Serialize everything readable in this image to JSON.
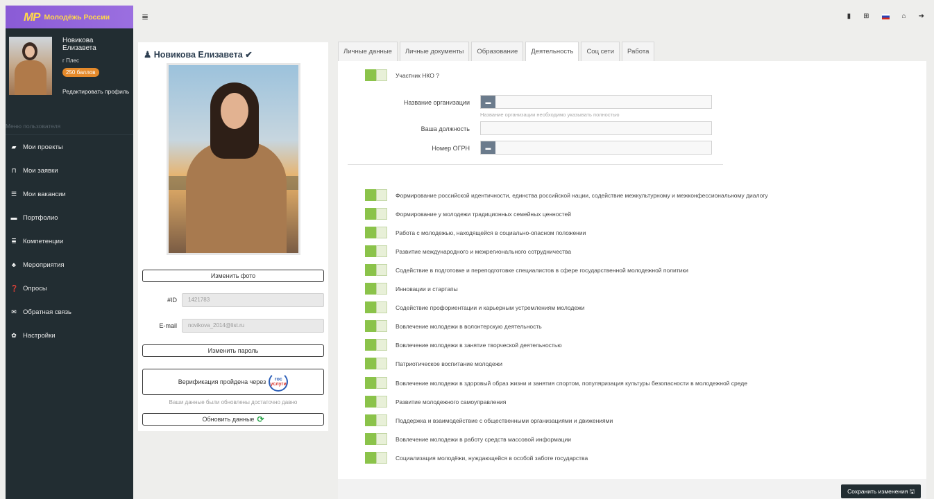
{
  "brand": {
    "mark": "MP",
    "name": "Молодёжь России"
  },
  "user": {
    "first": "Новикова",
    "last": "Елизавета",
    "city": "г Плес",
    "points": "250 баллов",
    "edit": "Редактировать профиль"
  },
  "menu_title": "Меню пользователя",
  "menu": [
    {
      "label": "Мои проекты",
      "icon": "book-icon",
      "glyph": "▰"
    },
    {
      "label": "Мои заявки",
      "icon": "bookmark-icon",
      "glyph": "⊓"
    },
    {
      "label": "Мои вакансии",
      "icon": "list-icon",
      "glyph": "☰"
    },
    {
      "label": "Портфолио",
      "icon": "folder-icon",
      "glyph": "▬"
    },
    {
      "label": "Компетенции",
      "icon": "table-icon",
      "glyph": "≣"
    },
    {
      "label": "Мероприятия",
      "icon": "sitemap-icon",
      "glyph": "♣"
    },
    {
      "label": "Опросы",
      "icon": "question-icon",
      "glyph": "❓"
    },
    {
      "label": "Обратная связь",
      "icon": "envelope-icon",
      "glyph": "✉"
    },
    {
      "label": "Настройки",
      "icon": "gear-icon",
      "glyph": "✿"
    }
  ],
  "profile": {
    "title": "Новикова Елизавета ✔",
    "change_photo": "Изменить фото",
    "id_label": "#ID",
    "id_value": "1421783",
    "email_label": "E-mail",
    "email_value": "novikova_2014@list.ru",
    "change_password": "Изменить пароль",
    "verification": "Верификация пройдена через",
    "gos_top": "гос",
    "gos_bottom": "услуги",
    "note": "Ваши данные были обновлены достаточно давно",
    "update": "Обновить данные"
  },
  "tabs": [
    "Личные данные",
    "Личные документы",
    "Образование",
    "Деятельность",
    "Соц сети",
    "Работа"
  ],
  "active_tab": "Деятельность",
  "nko": {
    "label": "Участник НКО ?",
    "org_label": "Название организации",
    "org_hint": "Название организации необходимо указывать полностью",
    "position_label": "Ваша должность",
    "ogrn_label": "Номер ОГРН"
  },
  "activities": [
    "Формирование российской идентичности, единства российской нации, содействие межкультурному и межконфессиональному диалогу",
    "Формирование у молодежи традиционных семейных ценностей",
    "Работа с молодежью, находящейся в социально-опасном положении",
    "Развитие международного и межрегионального сотрудничества",
    "Содействие в подготовке и переподготовке специалистов в сфере государственной молодежной политики",
    "Инновации и стартапы",
    "Содействие профориентации и карьерным устремлениям молодежи",
    "Вовлечение молодежи в волонтерскую деятельность",
    "Вовлечение молодежи в занятие творческой деятельностью",
    "Патриотическое воспитание молодежи",
    "Вовлечение молодежи в здоровый образ жизни и занятия спортом, популяризация культуры безопасности в молодежной среде",
    "Развитие молодежного самоуправления",
    "Поддержка и взаимодействие с общественными организациями и движениями",
    "Вовлечение молодежи в работу средств массовой информации",
    "Социализация молодёжи, нуждающейся в особой заботе государства"
  ],
  "save": "Сохранить изменения",
  "colors": {
    "sidebar": "#222d32",
    "brand": "#8a5bd6",
    "switch": "#8bc34a",
    "points": "#e58a2b"
  }
}
